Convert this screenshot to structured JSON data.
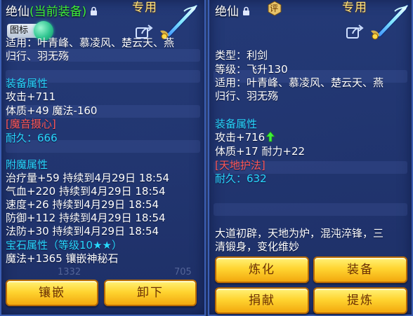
{
  "colors": {
    "title_text": "#ffffff",
    "current_equip": "#3ff03a",
    "exclusive": "#ffe27a",
    "section": "#29d8ff",
    "special": "#ff5858",
    "button_gold": "#ffd531",
    "button_text": "#6a2f04",
    "panel_bg": "#243a78"
  },
  "left": {
    "title_name": "绝仙",
    "title_status": "(当前装备)",
    "exclusive": "专用",
    "chip_label": "图标",
    "usage_line1": "适用：叶青峰、慕凌风、楚云天、燕",
    "usage_line2": "归行、羽无殇",
    "section_equip": "装备属性",
    "attack": "攻击+711",
    "stats": "体质+49 魔法-160",
    "skill": "[魔音摄心]",
    "durability": "耐久：666",
    "section_enchant": "附魔属性",
    "enchants": [
      "治疗量+59 持续到4月29日 18:54",
      "气血+220 持续到4月29日 18:54",
      "速度+26 持续到4月29日 18:54",
      "防御+112 持续到4月29日 18:54",
      "法防+30 持续到4月29日 18:54"
    ],
    "gem_title": "宝石属性（等级10★★）",
    "gem_effect": "魔法+1365 镶嵌神秘石",
    "bg_fragment_1": "1332",
    "bg_fragment_2": "705",
    "btn_inlay": "镶嵌",
    "btn_unequip": "卸下"
  },
  "right": {
    "title_name": "绝仙",
    "badge": "评",
    "exclusive": "专用",
    "type": "类型：利剑",
    "level": "等级：飞升130",
    "usage_line1": "适用：叶青峰、慕凌风、楚云天、燕",
    "usage_line2": "归行、羽无殇",
    "section_equip": "装备属性",
    "attack": "攻击+716",
    "stats": "体质+17 耐力+22",
    "skill": "[天地护法]",
    "durability": "耐久：632",
    "desc_line1": "大道初辟，天地为炉，混沌淬锋，三",
    "desc_line2": "清锻身，变化维妙",
    "btn_refine": "炼化",
    "btn_equip": "装备",
    "btn_donate": "捐献",
    "btn_extract": "提炼"
  },
  "icons": [
    "lock-icon",
    "share-icon",
    "weapon-sword-icon",
    "rating-badge-icon",
    "up-arrow-icon"
  ]
}
